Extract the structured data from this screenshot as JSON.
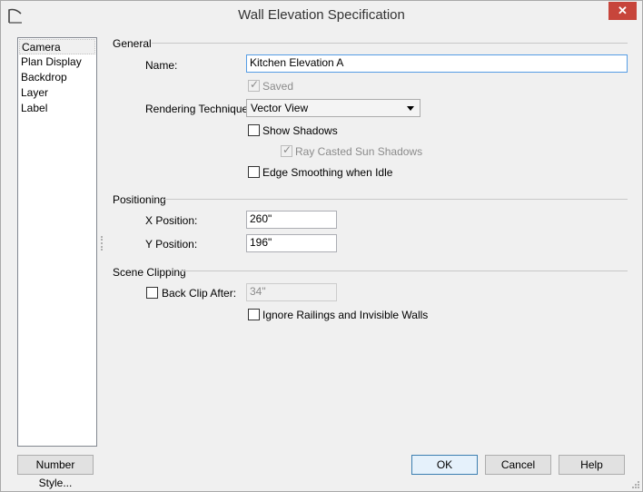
{
  "window": {
    "title": "Wall Elevation Specification",
    "close_label": "✕"
  },
  "sidebar": {
    "items": [
      {
        "label": "Camera"
      },
      {
        "label": "Plan Display"
      },
      {
        "label": "Backdrop"
      },
      {
        "label": "Layer"
      },
      {
        "label": "Label"
      }
    ]
  },
  "general": {
    "section_label": "General",
    "name_label": "Name:",
    "name_value": "Kitchen Elevation A",
    "saved_label": "Saved",
    "rendering_label": "Rendering Technique:",
    "rendering_value": "Vector View",
    "show_shadows_label": "Show Shadows",
    "ray_casted_label": "Ray Casted Sun Shadows",
    "edge_smoothing_label": "Edge Smoothing when Idle"
  },
  "positioning": {
    "section_label": "Positioning",
    "x_label": "X Position:",
    "x_value": "260\"",
    "y_label": "Y Position:",
    "y_value": "196\""
  },
  "clipping": {
    "section_label": "Scene Clipping",
    "back_clip_label": "Back Clip After:",
    "back_clip_value": "34\"",
    "ignore_label": "Ignore Railings and Invisible Walls"
  },
  "buttons": {
    "number_style": "Number Style...",
    "ok": "OK",
    "cancel": "Cancel",
    "help": "Help"
  }
}
